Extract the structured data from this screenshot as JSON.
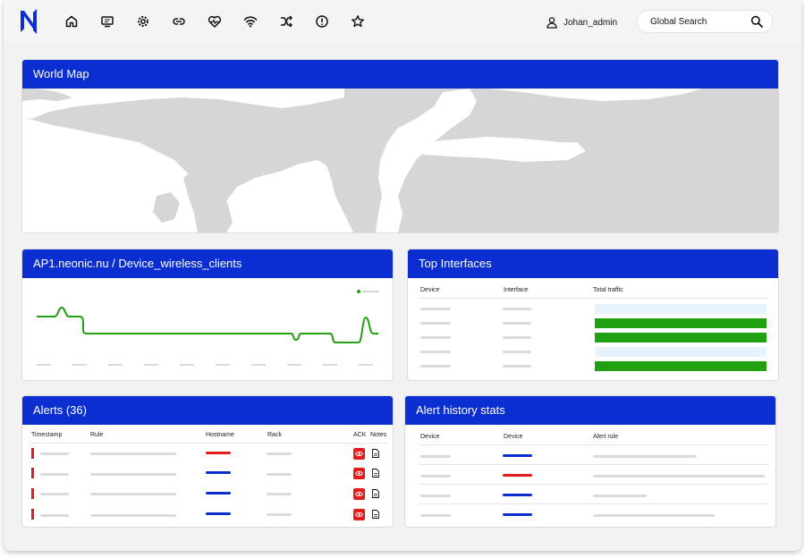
{
  "header": {
    "user_name": "Johan_admin",
    "search_label": "Global Search",
    "nav_icons": [
      "home-icon",
      "monitor-icon",
      "settings-icon",
      "link-icon",
      "health-icon",
      "wifi-icon",
      "shuffle-icon",
      "alert-icon",
      "star-icon"
    ]
  },
  "world_map": {
    "title": "World Map"
  },
  "wireless_panel": {
    "title": "AP1.neonic.nu / Device_wireless_clients",
    "series_color": "#21a012"
  },
  "top_interfaces": {
    "title": "Top Interfaces",
    "columns": [
      "Device",
      "Interface",
      "Total traffic"
    ],
    "rows": [
      {
        "traffic_fill": "light"
      },
      {
        "traffic_fill": "green"
      },
      {
        "traffic_fill": "green"
      },
      {
        "traffic_fill": "light"
      },
      {
        "traffic_fill": "green"
      }
    ]
  },
  "alerts": {
    "title": "Alerts (36)",
    "columns": [
      "Timestamp",
      "Rule",
      "Hostname",
      "Rack",
      "ACK",
      "Notes"
    ],
    "rows": [
      {
        "hostname_color": "red"
      },
      {
        "hostname_color": "blue"
      },
      {
        "hostname_color": "blue"
      },
      {
        "hostname_color": "blue"
      }
    ]
  },
  "alert_history": {
    "title": "Alert history stats",
    "columns": [
      "Device",
      "Device",
      "Alert rule"
    ],
    "rows": [
      {
        "device_color": "blue"
      },
      {
        "device_color": "red"
      },
      {
        "device_color": "blue"
      },
      {
        "device_color": "blue"
      }
    ]
  },
  "colors": {
    "brand_blue": "#0a2ed0",
    "alert_red": "#e31b1b",
    "traffic_green": "#21a012",
    "traffic_light": "#e6f2fc"
  }
}
